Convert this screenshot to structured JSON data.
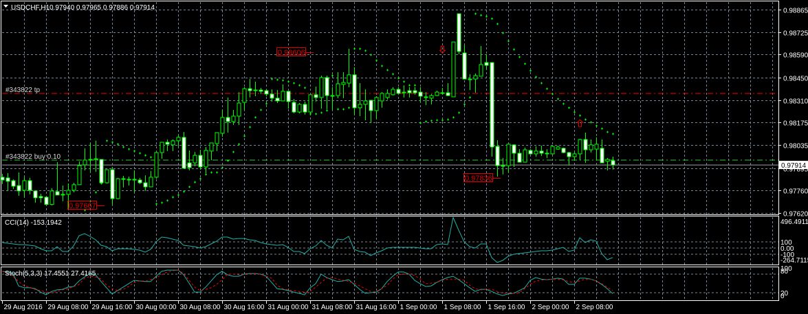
{
  "header": {
    "symbol": "USDCHF,H1",
    "ohlc": "0.97940 0.97965 0.97886 0.97914",
    "menu_icon": "triangle-down-icon"
  },
  "colors": {
    "background": "#000000",
    "grid": "#778899",
    "candle_outline": "#00ff00",
    "bear_body": "#ffffff",
    "bull_body": "#000000",
    "sar": "#00ff00",
    "tp_line": "#ff0000",
    "buy_line": "#32cd32",
    "bid_line": "#a0a0a0",
    "cci": "#20b2aa",
    "stoch_main": "#20b2aa",
    "stoch_signal": "#ff0000",
    "marker": "#e00000"
  },
  "trade_lines": {
    "tp_label": "#343822 tp",
    "tp_price": 0.98352,
    "buy_label": "#343822 buy 0.10",
    "buy_price": 0.97944,
    "bid_price": 0.97914,
    "bid_label": "0.97914"
  },
  "price_markers": [
    {
      "text": "0.98606",
      "bar": 50,
      "price": 0.98606
    },
    {
      "text": "0.97667",
      "bar": 12,
      "price": 0.97667
    },
    {
      "text": "0.97836",
      "bar": 84,
      "price": 0.97836
    }
  ],
  "arrows": [
    {
      "type": "sell-arrow-down",
      "bar": 80,
      "price": 0.9862
    },
    {
      "type": "buy-arrow-up",
      "bar": 105,
      "price": 0.9817
    }
  ],
  "price_axis": [
    "0.98865",
    "0.98725",
    "0.98590",
    "0.98450",
    "0.98310",
    "0.98175",
    "0.98035",
    "0.97895",
    "0.97760",
    "0.97620"
  ],
  "time_axis": [
    "29 Aug 2016",
    "29 Aug 08:00",
    "29 Aug 16:00",
    "30 Aug 00:00",
    "30 Aug 08:00",
    "30 Aug 16:00",
    "31 Aug 00:00",
    "31 Aug 08:00",
    "31 Aug 16:00",
    "1 Sep 00:00",
    "1 Sep 08:00",
    "1 Sep 16:00",
    "2 Sep 00:00",
    "2 Sep 08:00"
  ],
  "cci": {
    "label": "CCI(14) -153.1942",
    "axis": [
      "496.4911",
      "100",
      "0.00",
      "-100",
      "-264.7115"
    ],
    "levels": [
      100,
      0,
      -100
    ],
    "values": [
      89,
      78,
      67,
      56,
      56,
      44,
      33,
      -11,
      -44,
      -44,
      22,
      -56,
      -56,
      33,
      200,
      233,
      189,
      133,
      44,
      22,
      -44,
      -11,
      -11,
      -11,
      -22,
      -33,
      -67,
      -22,
      100,
      178,
      167,
      144,
      122,
      44,
      33,
      22,
      0,
      22,
      67,
      111,
      178,
      178,
      144,
      155,
      155,
      133,
      122,
      89,
      67,
      56,
      44,
      56,
      11,
      -56,
      -56,
      -89,
      -11,
      33,
      122,
      44,
      0,
      144,
      133,
      189,
      -22,
      -56,
      -67,
      -122,
      -78,
      -44,
      0,
      11,
      11,
      11,
      11,
      11,
      0,
      -11,
      -11,
      56,
      67,
      56,
      496,
      289,
      100,
      22,
      0,
      67,
      67,
      -155,
      -233,
      -200,
      -133,
      -100,
      -89,
      -78,
      -67,
      -56,
      -44,
      -44,
      -33,
      -11,
      11,
      -56,
      -33,
      167,
      89,
      133,
      111,
      -89,
      -189,
      -153
    ]
  },
  "stoch": {
    "label": "Stoch(5,3,3) 17.4551 27.4165",
    "axis": [
      "100",
      "80",
      "20",
      "0"
    ],
    "levels": [
      80,
      20
    ],
    "main": [
      89,
      87,
      82,
      42,
      36,
      36,
      33,
      22,
      13,
      24,
      29,
      31,
      38,
      40,
      58,
      71,
      82,
      78,
      56,
      36,
      16,
      27,
      38,
      49,
      60,
      58,
      56,
      56,
      73,
      89,
      93,
      93,
      93,
      78,
      51,
      22,
      22,
      38,
      58,
      78,
      89,
      78,
      73,
      73,
      80,
      82,
      82,
      80,
      73,
      53,
      33,
      31,
      27,
      22,
      18,
      13,
      36,
      49,
      80,
      69,
      62,
      56,
      58,
      62,
      47,
      31,
      18,
      20,
      22,
      33,
      56,
      73,
      87,
      87,
      80,
      60,
      49,
      40,
      42,
      53,
      62,
      69,
      73,
      62,
      49,
      36,
      24,
      31,
      31,
      24,
      16,
      11,
      16,
      18,
      27,
      36,
      60,
      69,
      64,
      62,
      64,
      67,
      64,
      47,
      47,
      67,
      67,
      64,
      58,
      47,
      33,
      17
    ],
    "signal": [
      89,
      82,
      73,
      56,
      42,
      38,
      31,
      27,
      22,
      20,
      24,
      29,
      33,
      40,
      47,
      67,
      73,
      71,
      64,
      44,
      33,
      27,
      31,
      40,
      53,
      58,
      58,
      62,
      69,
      78,
      87,
      91,
      93,
      82,
      60,
      38,
      27,
      31,
      36,
      47,
      62,
      80,
      80,
      78,
      78,
      80,
      82,
      80,
      73,
      67,
      44,
      33,
      29,
      27,
      24,
      22,
      24,
      38,
      53,
      67,
      69,
      64,
      60,
      56,
      51,
      42,
      33,
      24,
      24,
      33,
      44,
      64,
      78,
      80,
      80,
      76,
      64,
      49,
      51,
      53,
      60,
      64,
      64,
      64,
      60,
      44,
      33,
      29,
      31,
      31,
      24,
      18,
      18,
      18,
      20,
      33,
      47,
      58,
      60,
      62,
      64,
      64,
      62,
      56,
      53,
      58,
      64,
      64,
      58,
      49,
      38,
      27
    ]
  },
  "chart_data": {
    "type": "candlestick",
    "title": "USDCHF,H1",
    "ylim": [
      0.9762,
      0.98865
    ],
    "bar_period": "H1",
    "candles_ohlc": [
      [
        0.97839,
        0.9786,
        0.97797,
        0.97822
      ],
      [
        0.97835,
        0.97864,
        0.97759,
        0.97814
      ],
      [
        0.97818,
        0.97826,
        0.97767,
        0.97784
      ],
      [
        0.97788,
        0.97868,
        0.97725,
        0.97755
      ],
      [
        0.97759,
        0.97839,
        0.97717,
        0.97818
      ],
      [
        0.97818,
        0.97835,
        0.97734,
        0.97759
      ],
      [
        0.97755,
        0.97759,
        0.97683,
        0.97713
      ],
      [
        0.97721,
        0.97738,
        0.97683,
        0.97713
      ],
      [
        0.97717,
        0.97717,
        0.97667,
        0.97672
      ],
      [
        0.97672,
        0.97772,
        0.97667,
        0.97755
      ],
      [
        0.97751,
        0.97931,
        0.9773,
        0.9773
      ],
      [
        0.97734,
        0.97788,
        0.97692,
        0.97734
      ],
      [
        0.97734,
        0.97801,
        0.9765,
        0.97759
      ],
      [
        0.97759,
        0.97805,
        0.97746,
        0.97793
      ],
      [
        0.97793,
        0.97936,
        0.97793,
        0.9791
      ],
      [
        0.97915,
        0.98016,
        0.97881,
        0.97944
      ],
      [
        0.97948,
        0.98049,
        0.97872,
        0.97948
      ],
      [
        0.97952,
        0.98062,
        0.97872,
        0.97952
      ],
      [
        0.97948,
        0.97948,
        0.97797,
        0.97805
      ],
      [
        0.97805,
        0.97885,
        0.97801,
        0.97885
      ],
      [
        0.97885,
        0.97902,
        0.97671,
        0.97708
      ],
      [
        0.97708,
        0.97835,
        0.97704,
        0.9783
      ],
      [
        0.9783,
        0.97847,
        0.97776,
        0.9783
      ],
      [
        0.97826,
        0.97843,
        0.97788,
        0.97826
      ],
      [
        0.97826,
        0.97881,
        0.97746,
        0.97826
      ],
      [
        0.97822,
        0.97835,
        0.97797,
        0.97805
      ],
      [
        0.97805,
        0.97851,
        0.97755,
        0.9778
      ],
      [
        0.9778,
        0.97877,
        0.9778,
        0.97839
      ],
      [
        0.97839,
        0.9799,
        0.9783,
        0.9799
      ],
      [
        0.9799,
        0.98053,
        0.97952,
        0.98053
      ],
      [
        0.98053,
        0.9807,
        0.97999,
        0.98041
      ],
      [
        0.98037,
        0.9807,
        0.97999,
        0.98062
      ],
      [
        0.98062,
        0.98095,
        0.98028,
        0.98083
      ],
      [
        0.98083,
        0.98116,
        0.97894,
        0.97894
      ],
      [
        0.97927,
        0.98003,
        0.97881,
        0.97898
      ],
      [
        0.97927,
        0.97994,
        0.97906,
        0.97973
      ],
      [
        0.97973,
        0.98007,
        0.97885,
        0.97902
      ],
      [
        0.97902,
        0.98024,
        0.97864,
        0.98003
      ],
      [
        0.97999,
        0.98049,
        0.97944,
        0.98049
      ],
      [
        0.98045,
        0.98112,
        0.97999,
        0.98112
      ],
      [
        0.98108,
        0.98251,
        0.98086,
        0.98205
      ],
      [
        0.98205,
        0.98327,
        0.98112,
        0.9818
      ],
      [
        0.9818,
        0.98251,
        0.98159,
        0.98213
      ],
      [
        0.98213,
        0.9836,
        0.98159,
        0.98293
      ],
      [
        0.98297,
        0.9839,
        0.98251,
        0.98381
      ],
      [
        0.98381,
        0.9844,
        0.98327,
        0.98369
      ],
      [
        0.98373,
        0.98424,
        0.98335,
        0.98373
      ],
      [
        0.98373,
        0.98386,
        0.98348,
        0.98365
      ],
      [
        0.98369,
        0.98377,
        0.98335,
        0.98348
      ],
      [
        0.98348,
        0.98377,
        0.98302,
        0.98323
      ],
      [
        0.98323,
        0.98373,
        0.98293,
        0.98306
      ],
      [
        0.98306,
        0.98407,
        0.98306,
        0.98365
      ],
      [
        0.98365,
        0.98365,
        0.98259,
        0.98302
      ],
      [
        0.98297,
        0.98318,
        0.9823,
        0.98238
      ],
      [
        0.98238,
        0.98293,
        0.9823,
        0.98285
      ],
      [
        0.98285,
        0.98302,
        0.98222,
        0.98238
      ],
      [
        0.98238,
        0.98344,
        0.98222,
        0.98344
      ],
      [
        0.98344,
        0.98394,
        0.98302,
        0.98327
      ],
      [
        0.98327,
        0.98461,
        0.98259,
        0.98449
      ],
      [
        0.98449,
        0.98461,
        0.98255,
        0.98339
      ],
      [
        0.98339,
        0.9839,
        0.98251,
        0.98339
      ],
      [
        0.98339,
        0.98482,
        0.98323,
        0.98411
      ],
      [
        0.98407,
        0.98482,
        0.98323,
        0.98419
      ],
      [
        0.98415,
        0.98625,
        0.9839,
        0.98466
      ],
      [
        0.98466,
        0.98512,
        0.98222,
        0.98264
      ],
      [
        0.98264,
        0.98415,
        0.98213,
        0.98285
      ],
      [
        0.98285,
        0.98377,
        0.98188,
        0.98306
      ],
      [
        0.9831,
        0.9831,
        0.98171,
        0.98247
      ],
      [
        0.98247,
        0.98335,
        0.98196,
        0.98327
      ],
      [
        0.98306,
        0.9836,
        0.98264,
        0.98352
      ],
      [
        0.98327,
        0.98377,
        0.98314,
        0.98352
      ],
      [
        0.98344,
        0.9839,
        0.98339,
        0.98377
      ],
      [
        0.98377,
        0.9839,
        0.98348,
        0.98352
      ],
      [
        0.9836,
        0.98402,
        0.98327,
        0.9836
      ],
      [
        0.98369,
        0.9839,
        0.98327,
        0.98356
      ],
      [
        0.98369,
        0.9839,
        0.98344,
        0.98356
      ],
      [
        0.9836,
        0.9839,
        0.98302,
        0.98335
      ],
      [
        0.98331,
        0.9836,
        0.98281,
        0.98331
      ],
      [
        0.98323,
        0.98348,
        0.98285,
        0.98339
      ],
      [
        0.98339,
        0.98369,
        0.98335,
        0.9836
      ],
      [
        0.98356,
        0.98386,
        0.98344,
        0.98356
      ],
      [
        0.98356,
        0.98415,
        0.98335,
        0.98339
      ],
      [
        0.98331,
        0.98667,
        0.98331,
        0.98667
      ],
      [
        0.9884,
        0.9884,
        0.98592,
        0.98609
      ],
      [
        0.986,
        0.98646,
        0.9844,
        0.9844
      ],
      [
        0.9844,
        0.9847,
        0.98373,
        0.9844
      ],
      [
        0.9844,
        0.98474,
        0.98356,
        0.98461
      ],
      [
        0.98457,
        0.98642,
        0.98457,
        0.98529
      ],
      [
        0.98541,
        0.98592,
        0.98499,
        0.98524
      ],
      [
        0.98541,
        0.98541,
        0.97965,
        0.98024
      ],
      [
        0.98028,
        0.98066,
        0.97843,
        0.9791
      ],
      [
        0.9791,
        0.97957,
        0.97856,
        0.9791
      ],
      [
        0.9791,
        0.98041,
        0.97868,
        0.98041
      ],
      [
        0.98037,
        0.98041,
        0.97902,
        0.97986
      ],
      [
        0.97986,
        0.98011,
        0.97931,
        0.97931
      ],
      [
        0.97931,
        0.9802,
        0.97931,
        0.98007
      ],
      [
        0.98003,
        0.98011,
        0.97978,
        0.97982
      ],
      [
        0.97982,
        0.98028,
        0.97965,
        0.97999
      ],
      [
        0.97999,
        0.98032,
        0.97969,
        0.97986
      ],
      [
        0.97986,
        0.98011,
        0.97957,
        0.97986
      ],
      [
        0.97982,
        0.98032,
        0.97978,
        0.98028
      ],
      [
        0.98011,
        0.98032,
        0.98007,
        0.98024
      ],
      [
        0.98016,
        0.9802,
        0.97986,
        0.9799
      ],
      [
        0.9799,
        0.97994,
        0.9791,
        0.97965
      ],
      [
        0.97965,
        0.97994,
        0.97944,
        0.97982
      ],
      [
        0.97982,
        0.98074,
        0.97944,
        0.9807
      ],
      [
        0.9807,
        0.98112,
        0.97927,
        0.98007
      ],
      [
        0.98007,
        0.9807,
        0.9799,
        0.98037
      ],
      [
        0.98011,
        0.98083,
        0.9794,
        0.98041
      ],
      [
        0.98016,
        0.9807,
        0.97927,
        0.97927
      ],
      [
        0.97936,
        0.97957,
        0.97881,
        0.97948
      ],
      [
        0.9794,
        0.97965,
        0.97886,
        0.97914
      ]
    ],
    "parabolic_sar": [
      null,
      null,
      null,
      null,
      null,
      null,
      null,
      null,
      null,
      null,
      null,
      null,
      null,
      null,
      null,
      0.97637,
      0.97692,
      0.97746,
      0.97801,
      0.98062,
      0.98053,
      0.98041,
      0.98024,
      0.98011,
      0.97999,
      0.97986,
      0.97973,
      0.97961,
      0.97675,
      0.97683,
      0.97696,
      0.97717,
      0.9773,
      0.97751,
      0.9778,
      0.97809,
      0.9783,
      0.97856,
      0.97868,
      0.97868,
      0.97898,
      0.9794,
      0.97994,
      0.98041,
      0.98091,
      0.98146,
      0.98205,
      0.98251,
      0.98289,
      0.9844,
      0.98436,
      0.98432,
      0.98424,
      0.98415,
      0.98402,
      0.98386,
      0.98226,
      0.98226,
      0.98234,
      0.98247,
      0.98461,
      0.98255,
      0.98255,
      0.98264,
      0.98625,
      0.98625,
      0.98613,
      0.98588,
      0.98554,
      0.9852,
      0.98495,
      0.9847,
      0.98445,
      0.98424,
      0.98402,
      0.98402,
      0.98171,
      0.9818,
      0.98184,
      0.98188,
      0.98188,
      0.98192,
      0.98205,
      0.98234,
      0.98285,
      0.98327,
      0.9884,
      0.98831,
      0.98823,
      0.9881,
      0.98777,
      0.98722,
      0.98672,
      0.98621,
      0.98575,
      0.98533,
      0.98491,
      0.98453,
      0.98415,
      0.98381,
      0.98348,
      0.98318,
      0.98289,
      0.98264,
      0.98238,
      0.98217,
      0.98192,
      0.98175,
      0.98154,
      0.98137,
      0.98116,
      0.98104
    ]
  }
}
